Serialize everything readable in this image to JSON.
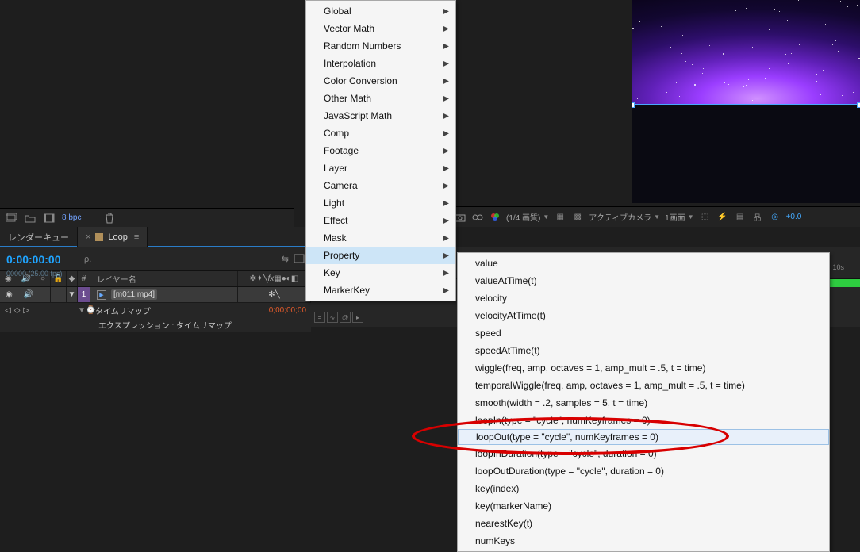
{
  "proj_bar": {
    "bpc": "8 bpc"
  },
  "tabs": {
    "render_queue": "レンダーキュー",
    "loop": "Loop"
  },
  "timeline": {
    "timecode": "0:00:00:00",
    "fps": "00000 (25.00 fps)",
    "search_ph": "ρ.",
    "col_num": "#",
    "col_name": "レイヤー名",
    "layer_num": "1",
    "layer_name": "[m011.mp4]",
    "prop_timeremap": "タイムリマップ",
    "prop_timeremap_val": "0;00;00;00",
    "prop_expr": "エクスプレッション : タイムリマップ"
  },
  "viewbar": {
    "quality": "(1/4 画質)",
    "camera": "アクティブカメラ",
    "views": "1画面",
    "zoom": "+0.0"
  },
  "ruler": {
    "sec": "10s"
  },
  "menu1": {
    "items": [
      "Global",
      "Vector Math",
      "Random Numbers",
      "Interpolation",
      "Color Conversion",
      "Other Math",
      "JavaScript Math",
      "Comp",
      "Footage",
      "Layer",
      "Camera",
      "Light",
      "Effect",
      "Mask",
      "Property",
      "Key",
      "MarkerKey"
    ],
    "highlight_index": 14
  },
  "menu2": {
    "items": [
      "value",
      "valueAtTime(t)",
      "velocity",
      "velocityAtTime(t)",
      "speed",
      "speedAtTime(t)",
      "wiggle(freq, amp, octaves = 1, amp_mult = .5, t = time)",
      "temporalWiggle(freq, amp, octaves = 1, amp_mult = .5, t = time)",
      "smooth(width = .2, samples = 5, t = time)",
      "loopIn(type = \"cycle\", numKeyframes = 0)",
      "loopOut(type = \"cycle\", numKeyframes = 0)",
      "loopInDuration(type = \"cycle\", duration = 0)",
      "loopOutDuration(type = \"cycle\", duration = 0)",
      "key(index)",
      "key(markerName)",
      "nearestKey(t)",
      "numKeys"
    ],
    "highlight_index": 10
  }
}
